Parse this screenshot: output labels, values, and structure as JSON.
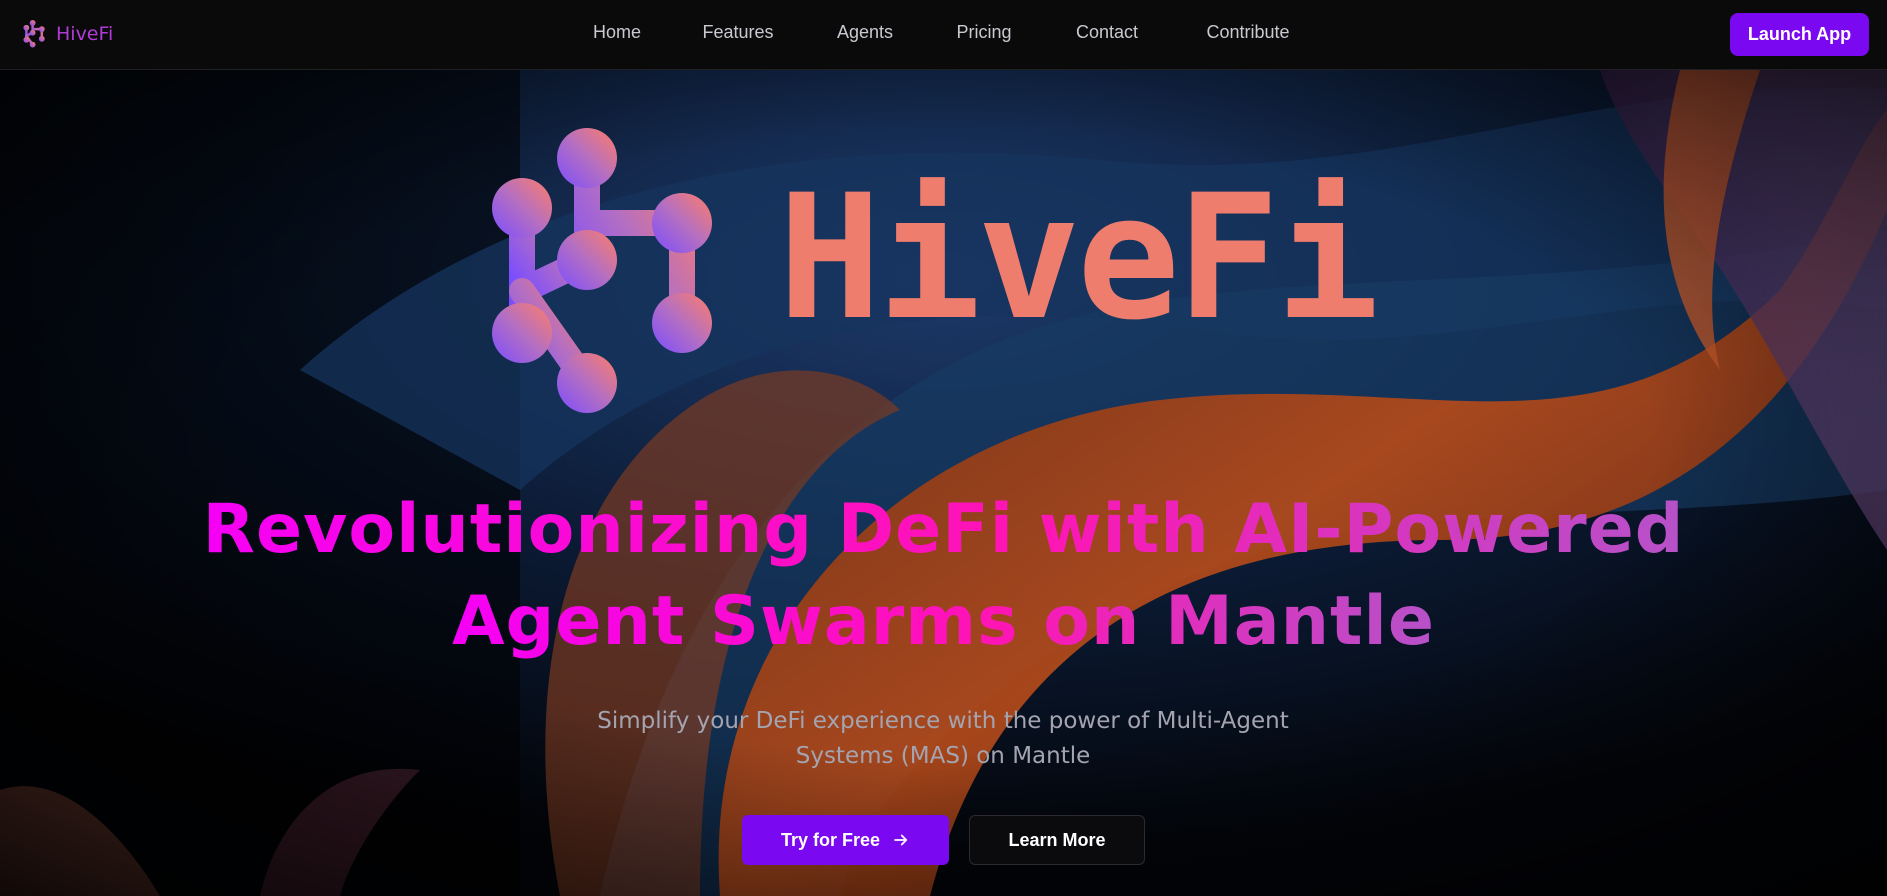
{
  "brand": {
    "name": "HiveFi",
    "color": "#b23ad8"
  },
  "nav": {
    "links": [
      {
        "label": "Home"
      },
      {
        "label": "Features"
      },
      {
        "label": "Agents"
      },
      {
        "label": "Pricing"
      },
      {
        "label": "Contact"
      },
      {
        "label": "Contribute"
      }
    ],
    "launch_label": "Launch App"
  },
  "hero": {
    "logo_icon": "hive-network-icon",
    "wordmark": "HiveFi",
    "headline_line1": "Revolutionizing DeFi with AI-Powered",
    "headline_line2": "Agent Swarms on Mantle",
    "subhead_line1": "Simplify your DeFi experience with the power of Multi-Agent",
    "subhead_line2": "Systems (MAS) on Mantle",
    "cta_primary": "Try for Free",
    "cta_primary_icon": "arrow-right-icon",
    "cta_secondary": "Learn More"
  },
  "colors": {
    "accent": "#7a08f0",
    "wordmark": "#ef7d6d",
    "headline_start": "#f500f5",
    "headline_end": "#b652c9",
    "background": "#000000"
  }
}
